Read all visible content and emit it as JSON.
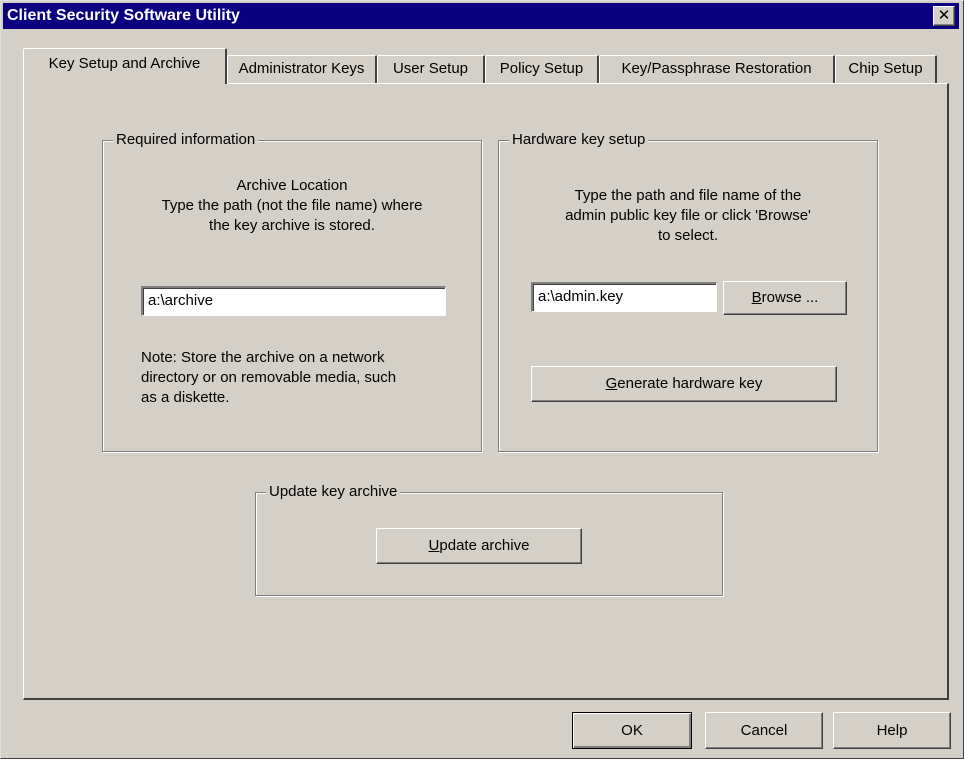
{
  "window": {
    "title": "Client Security Software Utility",
    "close_glyph": "✕"
  },
  "tabs": [
    {
      "label": "Key Setup and Archive",
      "active": true
    },
    {
      "label": "Administrator Keys",
      "active": false
    },
    {
      "label": "User Setup",
      "active": false
    },
    {
      "label": "Policy Setup",
      "active": false
    },
    {
      "label": "Key/Passphrase Restoration",
      "active": false
    },
    {
      "label": "Chip Setup",
      "active": false
    }
  ],
  "required_info": {
    "legend": "Required information",
    "heading_line1": "Archive Location",
    "heading_line2": "Type the path (not the file name) where",
    "heading_line3": "the key archive is stored.",
    "archive_path_value": "a:\\archive",
    "note_line1": "Note: Store the archive on a network",
    "note_line2": "directory or on removable media, such",
    "note_line3": "as a diskette."
  },
  "hardware_key": {
    "legend": "Hardware key setup",
    "desc_line1": "Type the path and file name of the",
    "desc_line2": "admin public key file or click 'Browse'",
    "desc_line3": "to select.",
    "key_file_value": "a:\\admin.key",
    "browse_mnemonic": "B",
    "browse_rest": "rowse ...",
    "generate_mnemonic": "G",
    "generate_rest": "enerate hardware key"
  },
  "update_archive": {
    "legend": "Update key archive",
    "button_mnemonic": "U",
    "button_rest": "pdate archive"
  },
  "footer": {
    "ok_label": "OK",
    "cancel_label": "Cancel",
    "help_label": "Help"
  }
}
